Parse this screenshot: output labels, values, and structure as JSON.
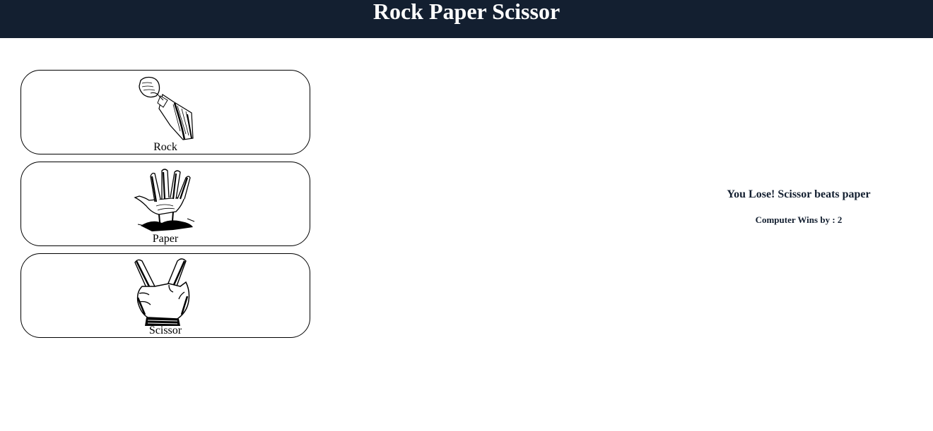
{
  "header": {
    "title": "Rock Paper Scissor"
  },
  "choices": [
    {
      "label": "Rock",
      "icon": "fist-hand-icon"
    },
    {
      "label": "Paper",
      "icon": "open-palm-hand-icon"
    },
    {
      "label": "Scissor",
      "icon": "two-finger-hand-icon"
    }
  ],
  "result": {
    "message": "You Lose! Scissor beats paper",
    "score_text": "Computer Wins by : 2"
  },
  "colors": {
    "header_bg": "#131f30",
    "header_text": "#ffffff",
    "result_text": "#131f30"
  }
}
